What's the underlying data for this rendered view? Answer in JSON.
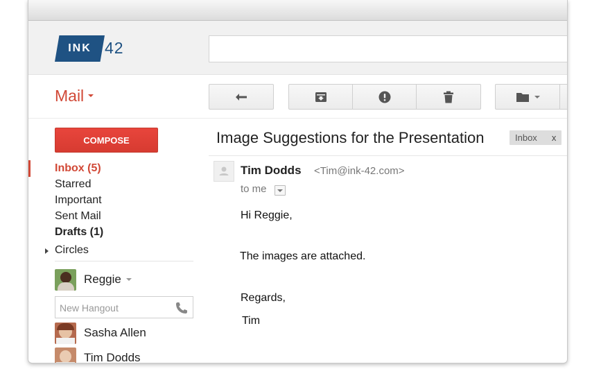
{
  "header": {
    "logo": {
      "tag_text": "INK",
      "number_text": "42",
      "brand_color": "#1f5283"
    },
    "search": {
      "placeholder": "",
      "value": ""
    }
  },
  "toolbar": {
    "mail_label": "Mail",
    "accent_color": "#d14836",
    "buttons": [
      {
        "name": "reply",
        "icon": "reply-arrow-icon"
      },
      {
        "name": "archive",
        "icon": "archive-box-icon"
      },
      {
        "name": "report-spam",
        "icon": "exclamation-icon"
      },
      {
        "name": "delete",
        "icon": "trash-icon"
      },
      {
        "name": "move-to",
        "icon": "folder-icon"
      }
    ]
  },
  "sidebar": {
    "compose_label": "COMPOSE",
    "nav": {
      "inbox": "Inbox (5)",
      "starred": "Starred",
      "important": "Important",
      "sent": "Sent Mail",
      "drafts": "Drafts (1)",
      "circles": "Circles"
    },
    "hangouts": {
      "self_name": "Reggie",
      "new_hangout_placeholder": "New Hangout",
      "contacts": [
        "Sasha Allen",
        "Tim Dodds"
      ]
    }
  },
  "message": {
    "subject": "Image Suggestions for the Presentation",
    "label": "Inbox",
    "label_remove": "x",
    "sender_name": "Tim Dodds",
    "sender_email": "<Tim@ink-42.com>",
    "recipient": "to me",
    "body": {
      "greeting": "Hi Reggie,",
      "main": "The images are attached.",
      "closing": "Regards,",
      "signature": "Tim"
    }
  }
}
